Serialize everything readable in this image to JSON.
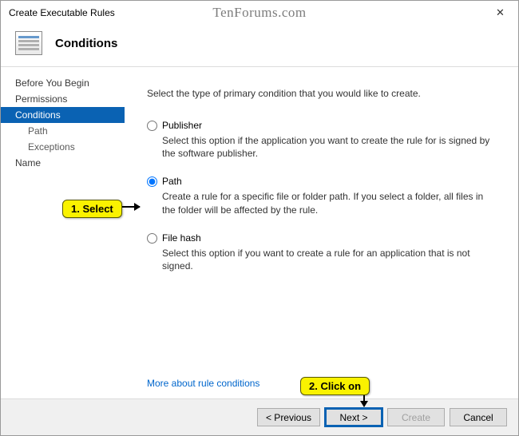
{
  "window": {
    "title": "Create Executable Rules",
    "watermark": "TenForums.com"
  },
  "header": {
    "title": "Conditions"
  },
  "sidebar": {
    "items": [
      {
        "label": "Before You Begin",
        "selected": false,
        "sub": false
      },
      {
        "label": "Permissions",
        "selected": false,
        "sub": false
      },
      {
        "label": "Conditions",
        "selected": true,
        "sub": false
      },
      {
        "label": "Path",
        "selected": false,
        "sub": true
      },
      {
        "label": "Exceptions",
        "selected": false,
        "sub": true
      },
      {
        "label": "Name",
        "selected": false,
        "sub": false
      }
    ]
  },
  "content": {
    "intro": "Select the type of primary condition that you would like to create.",
    "options": {
      "publisher": {
        "label": "Publisher",
        "desc": "Select this option if the application you want to create the rule for is signed by the software publisher."
      },
      "path": {
        "label": "Path",
        "desc": "Create a rule for a specific file or folder path. If you select a folder, all files in the folder will be affected by the rule."
      },
      "filehash": {
        "label": "File hash",
        "desc": "Select this option if you want to create a rule for an application that is not signed."
      }
    },
    "more_link": "More about rule conditions"
  },
  "footer": {
    "previous": "< Previous",
    "next": "Next >",
    "create": "Create",
    "cancel": "Cancel"
  },
  "annotations": {
    "step1": "1. Select",
    "step2": "2. Click on"
  }
}
